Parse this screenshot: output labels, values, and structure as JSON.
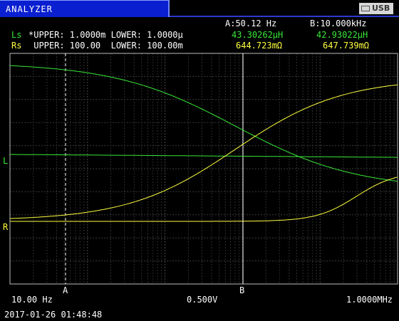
{
  "window": {
    "title": "ANALYZER",
    "usb_label": "USB"
  },
  "cursors": {
    "a_freq": "A:50.12 Hz",
    "b_freq": "B:10.000kHz",
    "a_label": "A",
    "b_label": "B"
  },
  "ls_row": {
    "label": "Ls",
    "limits": "*UPPER: 1.0000m LOWER: 1.0000µ",
    "value_a": "43.30262µH",
    "value_b": "42.93022µH"
  },
  "rs_row": {
    "label": "Rs",
    "limits": " UPPER: 100.00  LOWER: 100.00m",
    "value_a": "644.723mΩ",
    "value_b": "647.739mΩ"
  },
  "axis": {
    "ls_marker": "L",
    "rs_marker": "R",
    "x_start": "10.00 Hz",
    "x_mid": "0.500V",
    "x_end": "1.0000MHz"
  },
  "status": {
    "timestamp": "2017-01-26 01:48:48"
  },
  "colors": {
    "ls": "#38e838",
    "rs": "#ffff40",
    "title_bar": "#0a1fd0"
  }
}
